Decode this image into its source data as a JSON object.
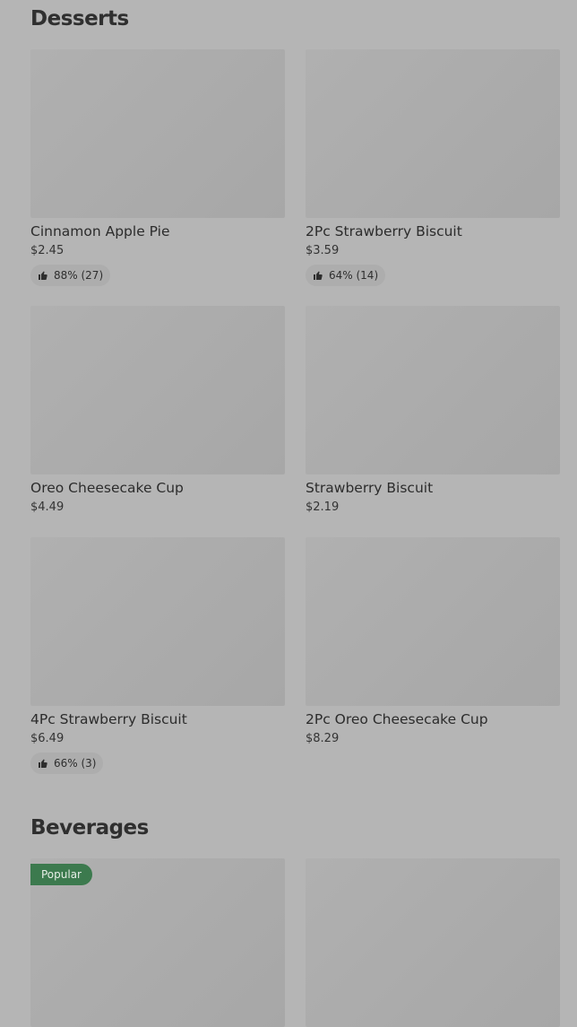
{
  "sections": {
    "desserts": {
      "title": "Desserts",
      "items": [
        {
          "name": "Cinnamon Apple Pie",
          "price": "$2.45",
          "rating": "88% (27)"
        },
        {
          "name": "2Pc Strawberry Biscuit",
          "price": "$3.59",
          "rating": "64% (14)"
        },
        {
          "name": "Oreo Cheesecake Cup",
          "price": "$4.49"
        },
        {
          "name": "Strawberry Biscuit",
          "price": "$2.19"
        },
        {
          "name": "4Pc Strawberry Biscuit",
          "price": "$6.49",
          "rating": "66% (3)"
        },
        {
          "name": "2Pc Oreo Cheesecake Cup",
          "price": "$8.29"
        }
      ]
    },
    "beverages": {
      "title": "Beverages",
      "items": [
        {
          "badge": "Popular"
        },
        {}
      ]
    }
  },
  "icons": {
    "rating": "thumbs-up-icon"
  },
  "colors": {
    "background": "#b5b5b5",
    "badge": "#3c7a4e"
  }
}
